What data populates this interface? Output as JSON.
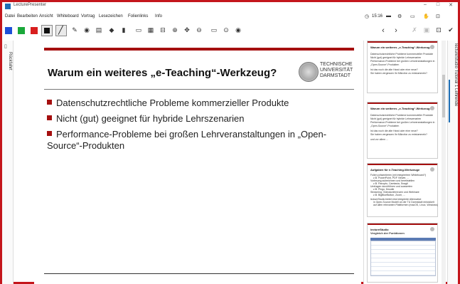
{
  "app": {
    "title": "LecturePresenter"
  },
  "menu": {
    "items": [
      "Datei",
      "Bearbeiten",
      "Ansicht",
      "Whiteboard",
      "Vortrag",
      "Lesezeichen",
      "Folienlinks",
      "Info"
    ],
    "time": "15:16"
  },
  "toolbar": {
    "colors": [
      "#1e50d8",
      "#1aa83a",
      "#d81e1e",
      "#111111"
    ]
  },
  "left_panel": {
    "label": "Rückfahrt"
  },
  "right_panel": {
    "label": "lectureStudio Tutorial 1 Lehrende"
  },
  "slide": {
    "title": "Warum ein weiteres „e-Teaching“-Werkzeug?",
    "logo_text": [
      "TECHNISCHE",
      "UNIVERSITÄT",
      "DARMSTADT"
    ],
    "bullets": [
      "Datenschutzrechtliche Probleme kommerzieller Produkte",
      "Nicht (gut) geeignet für hybride Lehrszenarien",
      "Performance-Probleme bei großen Lehrveranstaltungen in „Open-Source“-Produkten"
    ]
  },
  "thumbnails": [
    {
      "title": "Warum ein weiteres „e-Teaching“-Werkzeug?",
      "lines": [
        "Datenschutzrechtliche Probleme kommerzieller Produkte",
        "Nicht (gut) geeignet für hybride Lehrszenarien",
        "Performance-Probleme bei großen Lehrveranstaltungen in",
        "„Open-Source“-Produkten",
        "Ist das noch die alte Hand oder eine neue?",
        "Sie haben vergessen Ihr Mikrofon zu entstummeln?"
      ]
    },
    {
      "title": "Warum ein weiteres „e-Teaching“-Werkzeug?",
      "lines": [
        "Datenschutzrechtliche Probleme kommerzieller Produkte",
        "Nicht (gut) geeignet für hybride Lehrszenarien",
        "Performance-Probleme bei großen Lehrveranstaltungen in",
        "„Open-Source“-Produkten",
        "Ist das noch die alte Hand oder eine neue?",
        "Sie haben vergessen Ihr Mikrofon zu entstummeln?",
        "und vor allem ..."
      ]
    },
    {
      "title": "Aufgaben für e-Teaching-Werkzeuge",
      "lines": [
        "Folien präsentieren (mit integriertem Whiteboard?)",
        "z.B. PowerPoint, PDF Viewer, ...",
        "Vorlesung aufzeichnen und bereitstellen",
        "z.B. Panopto, Camtasia, Snagit",
        "Umfragen durchführen und auswerten",
        "z.B. Pingo, Moodle",
        "Streaming: Videokonferenzen und Webinare",
        "z.B. BigBlueButton, Zoom, ...",
        "lectureStudio bietet eine integrierte Alternative",
        "in Open-Source Modell an der TU Darmstadt entwickelt",
        "auf allen relevanten Plattformen (macOS, Linux, Windows)"
      ]
    },
    {
      "title": "lectureStudio",
      "subtitle": "Vergleich der Funktionen",
      "lines": []
    }
  ]
}
